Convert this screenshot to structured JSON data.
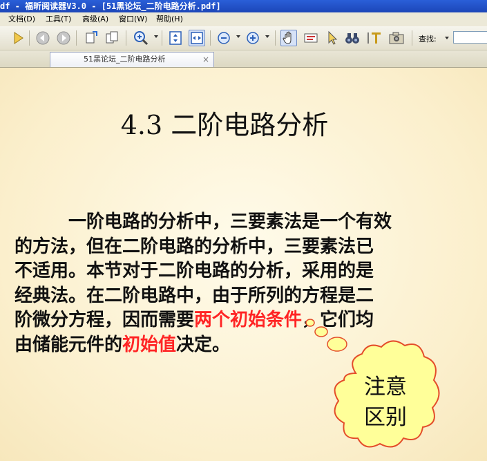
{
  "window": {
    "title": "df - 福昕阅读器V3.0 - [51黑论坛_二阶电路分析.pdf]"
  },
  "menu": [
    "文档(D)",
    "工具(T)",
    "高级(A)",
    "窗口(W)",
    "帮助(H)"
  ],
  "toolbar": {
    "find_label": "查找:",
    "find_value": ""
  },
  "tabs": [
    {
      "label": "51黑论坛_二阶电路分析",
      "close": "×"
    }
  ],
  "slide": {
    "heading": "4.3  二阶电路分析",
    "lines": [
      "一阶电路的分析中，三要素法是一个有效",
      "的方法，但在二阶电路的分析中，三要素法已",
      "不适用。本节对于二阶电路的分析，采用的是",
      "经典法。在二阶电路中，由于所列的方程是二"
    ],
    "line5_a": "阶微分方程，因而需要",
    "line5_highlight": "两个初始条件",
    "line5_b": "，它们均",
    "line6_a": "由储能元件的",
    "line6_highlight": "初始值",
    "line6_b": "决定。",
    "callout": [
      "注意",
      "区别"
    ],
    "highlight_color": "#ff2424",
    "bubble_color": "#ffff99"
  }
}
